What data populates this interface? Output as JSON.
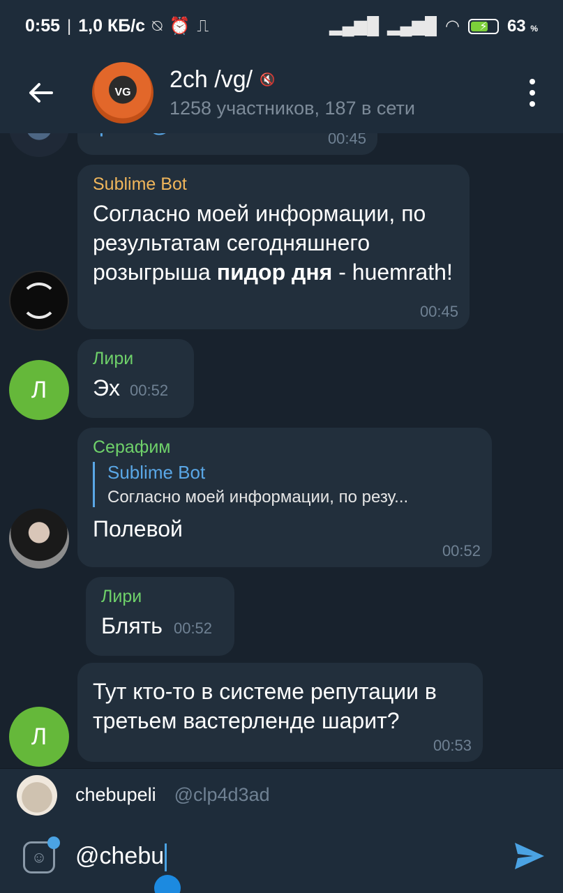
{
  "status_bar": {
    "time": "0:55",
    "speed": "1,0 КБ/с",
    "battery_level": "63",
    "battery_unit": "%"
  },
  "header": {
    "title": "2ch /vg/",
    "subtitle": "1258 участников, 187 в сети"
  },
  "messages": [
    {
      "author": "",
      "text": "/pidor@SublimeBot",
      "time": "00:45"
    },
    {
      "author": "Sublime Bot",
      "text_plain_1": "Согласно моей информации, по результатам сегодняшнего розыгрыша ",
      "text_bold": "пидор дня",
      "text_plain_2": " - huemrath!",
      "time": "00:45"
    },
    {
      "author": "Лири",
      "avatar_letter": "Л",
      "text": "Эх",
      "time": "00:52"
    },
    {
      "author": "Серафим",
      "reply_author": "Sublime Bot",
      "reply_text": "Согласно моей информации, по резу...",
      "text": "Полевой",
      "time": "00:52"
    },
    {
      "author": "Лири",
      "text": "Блять",
      "time": "00:52"
    },
    {
      "author": "",
      "avatar_letter": "Л",
      "text": "Тут кто-то в системе репутации в третьем вастерленде шарит?",
      "time": "00:53"
    }
  ],
  "mention_suggestion": {
    "name": "chebupeli",
    "username": "@clp4d3ad"
  },
  "input": {
    "value": "@chebu"
  },
  "colors": {
    "background": "#18222d",
    "bar": "#1e2c3a",
    "bubble": "#222f3c",
    "accent_blue": "#4ba3e3",
    "author_orange": "#f0b65b",
    "author_green": "#6fd16a",
    "avatar_green": "#65b83a"
  },
  "icons": {
    "back": "arrow-left-icon",
    "mute": "muted-icon",
    "menu": "more-vertical-icon",
    "sticker": "sticker-icon",
    "send": "send-icon"
  }
}
